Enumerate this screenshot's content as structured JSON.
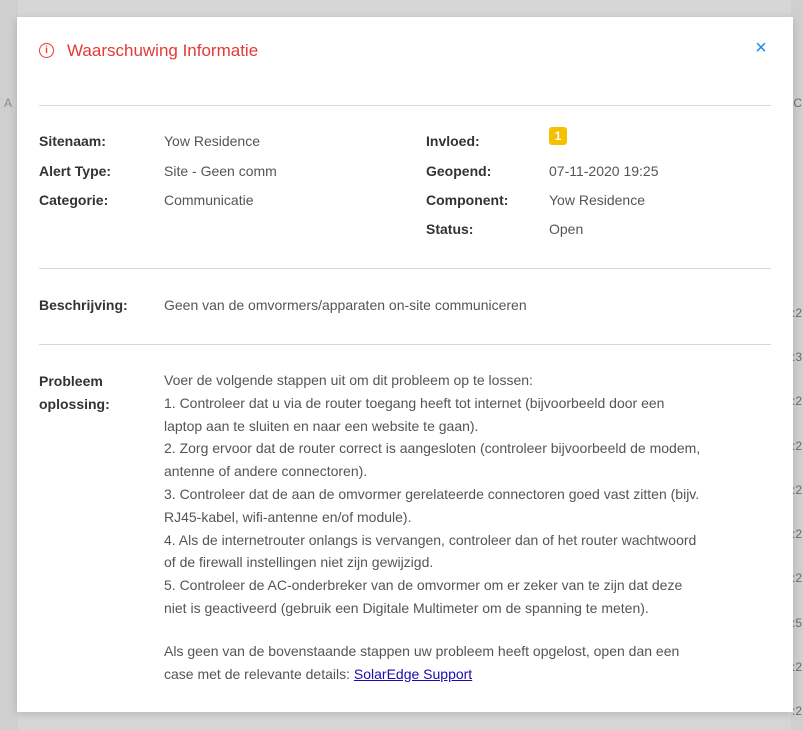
{
  "modal": {
    "title": "Waarschuwing Informatie",
    "close_label": "×",
    "info_icon": "info-icon"
  },
  "details": {
    "sitenaam_label": "Sitenaam:",
    "sitenaam_value": "Yow Residence",
    "alert_type_label": "Alert Type:",
    "alert_type_value": "Site - Geen comm",
    "categorie_label": "Categorie:",
    "categorie_value": "Communicatie",
    "invloed_label": "Invloed:",
    "invloed_value": "1",
    "geopend_label": "Geopend:",
    "geopend_value": "07-11-2020 19:25",
    "component_label": "Component:",
    "component_value": "Yow Residence",
    "status_label": "Status:",
    "status_value": "Open"
  },
  "beschrijving": {
    "label": "Beschrijving:",
    "value": "Geen van de omvormers/apparaten on-site communiceren"
  },
  "probleem": {
    "label_line1": "Probleem",
    "label_line2": "oplossing:",
    "lines": [
      "Voer de volgende stappen uit om dit probleem op te lossen:",
      "1. Controleer dat u via de router toegang heeft tot internet (bijvoorbeeld door een",
      "laptop aan te sluiten en naar een website te gaan).",
      "2. Zorg ervoor dat de router correct is aangesloten (controleer bijvoorbeeld de modem,",
      "antenne of andere connectoren).",
      "3. Controleer dat de aan de omvormer gerelateerde connectoren goed vast zitten (bijv.",
      "RJ45-kabel, wifi-antenne en/of module).",
      "4. Als de internetrouter onlangs is vervangen, controleer dan of het router wachtwoord",
      "of de firewall instellingen niet zijn gewijzigd.",
      "5. Controleer de AC-onderbreker van de omvormer om er zeker van te zijn dat deze",
      "niet is geactiveerd (gebruik een Digitale Multimeter om de spanning te meten)."
    ],
    "closing_line1": "Als geen van de bovenstaande stappen uw probleem heeft opgelost, open dan een",
    "closing_line2": "case met de relevante details: ",
    "support_link": "SolarEdge Support"
  },
  "background": {
    "left_edge_chars": [
      "A"
    ],
    "right_edge_chars": [
      "C",
      ":2",
      ":3",
      ":2",
      ":2",
      ":2",
      ":2",
      ":2",
      ":5",
      ":2",
      ":2"
    ]
  }
}
